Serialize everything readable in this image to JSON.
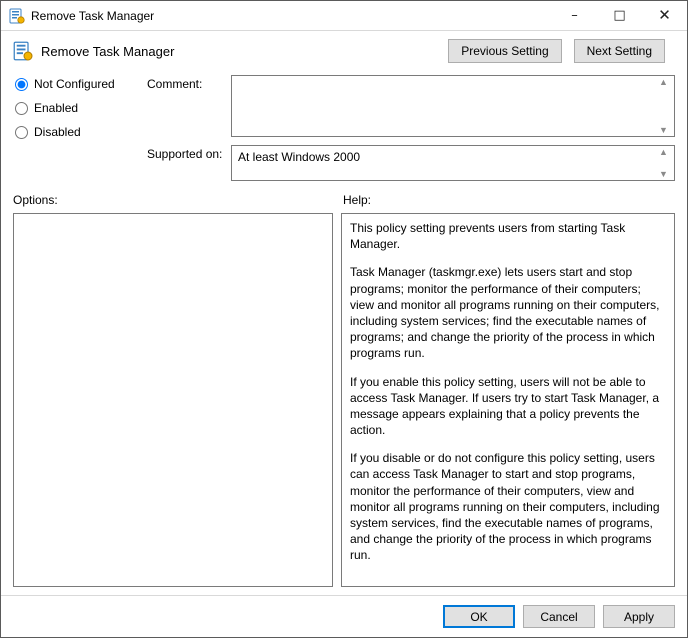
{
  "window": {
    "title": "Remove Task Manager"
  },
  "header": {
    "title": "Remove Task Manager",
    "prev": "Previous Setting",
    "next": "Next Setting"
  },
  "state": {
    "not_configured": "Not Configured",
    "enabled": "Enabled",
    "disabled": "Disabled",
    "selected": "not_configured"
  },
  "comment": {
    "label": "Comment:",
    "value": ""
  },
  "supported": {
    "label": "Supported on:",
    "value": "At least Windows 2000"
  },
  "panels": {
    "options_label": "Options:",
    "help_label": "Help:"
  },
  "help": {
    "p1": "This policy setting prevents users from starting Task Manager.",
    "p2": "Task Manager (taskmgr.exe) lets users start and stop programs; monitor the performance of their computers; view and monitor all programs running on their computers, including system services; find the executable names of programs; and change the priority of the process in which programs run.",
    "p3": "If you enable this policy setting, users will not be able to access Task Manager. If users try to start Task Manager, a message appears explaining that a policy prevents the action.",
    "p4": "If you disable or do not configure this policy setting, users can access Task Manager to  start and stop programs, monitor the performance of their computers, view and monitor all programs running on their computers, including system services, find the executable names of programs, and change the priority of the process in which programs run."
  },
  "footer": {
    "ok": "OK",
    "cancel": "Cancel",
    "apply": "Apply"
  }
}
